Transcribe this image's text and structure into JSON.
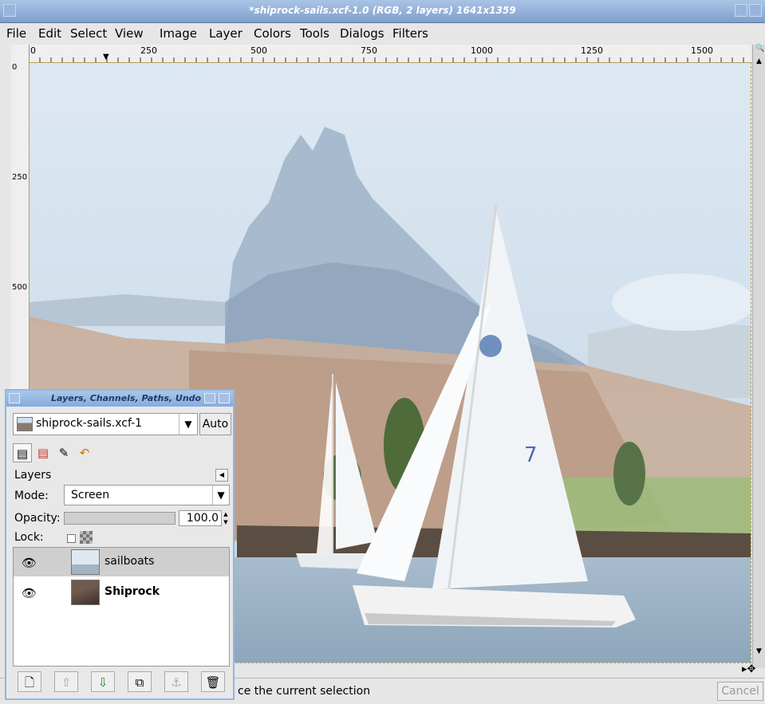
{
  "window": {
    "title": "*shiprock-sails.xcf-1.0 (RGB, 2 layers) 1641x1359"
  },
  "menubar": [
    "File",
    "Edit",
    "Select",
    "View",
    "Image",
    "Layer",
    "Colors",
    "Tools",
    "Dialogs",
    "Filters"
  ],
  "rulers": {
    "horizontal": [
      "0",
      "250",
      "500",
      "750",
      "1000",
      "1250",
      "1500"
    ],
    "vertical": [
      "0",
      "250",
      "500"
    ]
  },
  "statusbar": {
    "message": "ce the current selection",
    "cancel_label": "Cancel"
  },
  "dock": {
    "title": "Layers, Channels, Paths, Undo",
    "image_selector": "shiprock-sails.xcf-1",
    "auto_label": "Auto",
    "tabs": [
      "layers-tab-icon",
      "channels-tab-icon",
      "paths-tab-icon",
      "undo-tab-icon"
    ],
    "panel_label": "Layers",
    "mode_label": "Mode:",
    "mode_value": "Screen",
    "opacity_label": "Opacity:",
    "opacity_value": "100.0",
    "opacity_fraction": 1.0,
    "lock_label": "Lock:",
    "layers": [
      {
        "name": "sailboats",
        "visible": true,
        "selected": true
      },
      {
        "name": "Shiprock",
        "visible": true,
        "selected": false
      }
    ],
    "buttons": [
      "new-layer-icon",
      "raise-layer-icon",
      "lower-layer-icon",
      "duplicate-layer-icon",
      "anchor-layer-icon",
      "delete-layer-icon"
    ]
  },
  "colors": {
    "titlebar": "#8fb0dc",
    "accent": "#8fb6e2"
  }
}
